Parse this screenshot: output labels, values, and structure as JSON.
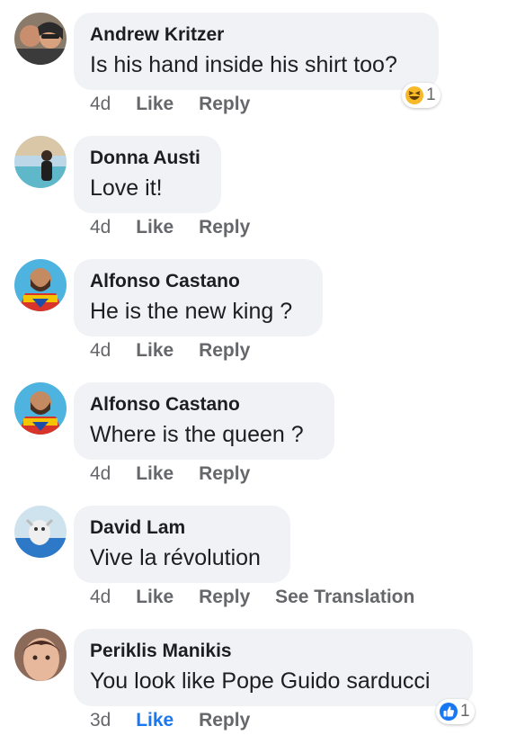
{
  "comments": [
    {
      "author": "Andrew Kritzer",
      "text": "Is his hand inside his shirt too?",
      "time": "4d",
      "like": "Like",
      "reply": "Reply",
      "reaction": {
        "icon": "haha-emoji-icon",
        "count": "1"
      }
    },
    {
      "author": "Donna Austi",
      "text": "Love it!",
      "time": "4d",
      "like": "Like",
      "reply": "Reply"
    },
    {
      "author": "Alfonso Castano",
      "text": "He is the new king ?",
      "time": "4d",
      "like": "Like",
      "reply": "Reply"
    },
    {
      "author": "Alfonso Castano",
      "text": "Where is the queen ?",
      "time": "4d",
      "like": "Like",
      "reply": "Reply"
    },
    {
      "author": "David Lam",
      "text": "Vive la révolution",
      "time": "4d",
      "like": "Like",
      "reply": "Reply",
      "see_translation": "See Translation"
    },
    {
      "author": "Periklis Manikis",
      "text": "You look like Pope Guido sarducci",
      "time": "3d",
      "like": "Like",
      "reply": "Reply",
      "liked": true,
      "reaction": {
        "icon": "thumbs-up-icon",
        "count": "1"
      }
    }
  ],
  "colors": {
    "bubble": "#f0f2f5",
    "meta_text": "#65676b",
    "liked": "#1877f2",
    "haha": "#f7b928"
  }
}
